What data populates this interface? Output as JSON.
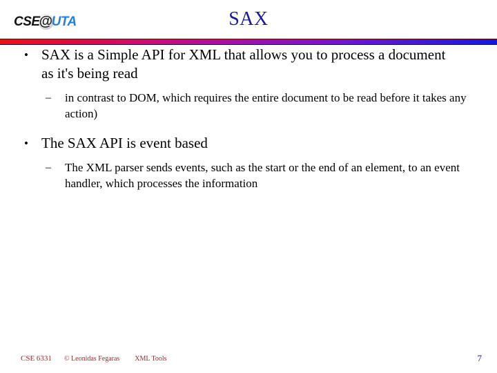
{
  "header": {
    "logo": {
      "name": "cse-uta-logo",
      "part1": "CSE",
      "at_symbol": "@",
      "part2": "UTA",
      "part1_color": "#111111",
      "part2_color": "#2a7fd4"
    },
    "title": "SAX",
    "title_color": "#1b1b8f",
    "divider": {
      "start_color": "#ee1111",
      "mid_color": "#a80fa8",
      "end_color": "#1414ee"
    }
  },
  "content": {
    "bullets": [
      {
        "level": 1,
        "marker": "•",
        "text": "SAX is a Simple API for XML that allows you to process a document as it's being read"
      },
      {
        "level": 2,
        "marker": "–",
        "text": "in contrast to DOM, which requires the entire document to be read before it takes any action)"
      },
      {
        "level": 1,
        "marker": "•",
        "text": "The SAX API is event based"
      },
      {
        "level": 2,
        "marker": "–",
        "text": "The XML parser sends events, such as the start or the end of an element, to an event handler, which processes the information"
      }
    ]
  },
  "footer": {
    "course": "CSE 6331",
    "copyright": "© Leonidas Fegaras",
    "topic": "XML Tools",
    "page_number": "7",
    "text_color": "#8f2b2b",
    "page_number_color": "#1b1b8f"
  }
}
